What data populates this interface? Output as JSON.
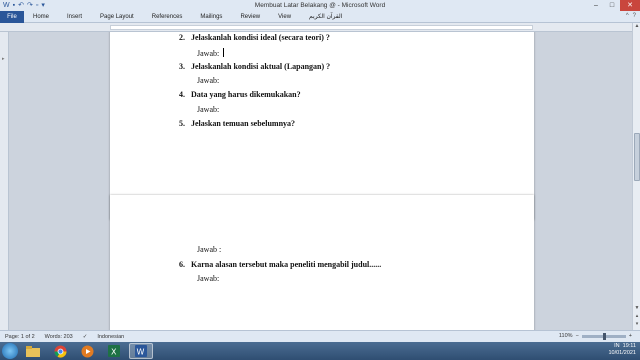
{
  "window": {
    "title": "Membuat Latar Belakang @ - Microsoft Word"
  },
  "ribbon": {
    "file_label": "File",
    "tabs": [
      "Home",
      "Insert",
      "Page Layout",
      "References",
      "Mailings",
      "Review",
      "View",
      "القرآن الكريم"
    ]
  },
  "document": {
    "page1": {
      "q2_num": "2.",
      "q2_text": "Jelaskanlah kondisi ideal (secara teori) ?",
      "a2": "Jawab:",
      "q3_num": "3.",
      "q3_text": "Jelaskanlah kondisi aktual (Lapangan) ?",
      "a3": "Jawab:",
      "q4_num": "4.",
      "q4_text": "Data yang harus dikemukakan?",
      "a4": "Jawab:",
      "q5_num": "5.",
      "q5_text": "Jelaskan temuan sebelumnya?"
    },
    "page2": {
      "a5": "Jawab :",
      "q6_num": "6.",
      "q6_text": "Karna alasan tersebut maka peneliti mengabil judul......",
      "a6": "Jawab:"
    }
  },
  "statusbar": {
    "page": "Page: 1 of 2",
    "words": "Words: 203",
    "language": "Indonesian",
    "zoom": "110%"
  },
  "taskbar": {
    "time": "19:11",
    "date": "10/01/2021",
    "lang": "IN"
  }
}
